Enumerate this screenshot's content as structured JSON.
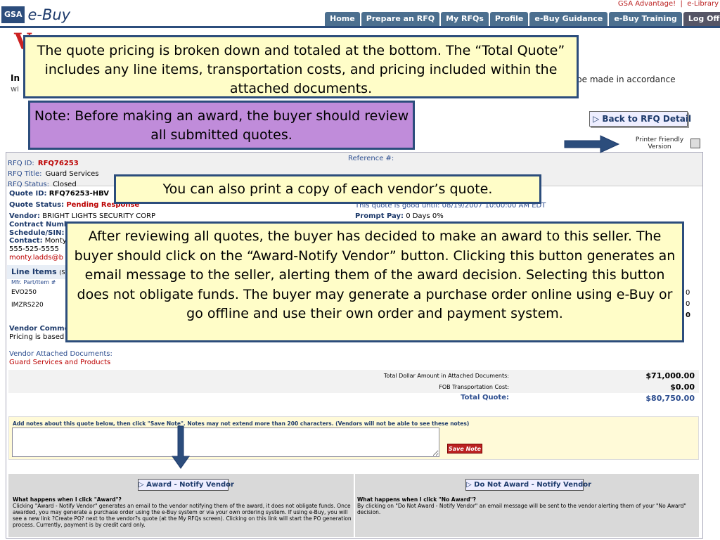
{
  "header": {
    "logo_box": "GSA",
    "logo_text": "e-Buy",
    "top_links": [
      "GSA Advantage!",
      "e-Library"
    ],
    "tabs": [
      "Home",
      "Prepare an RFQ",
      "My RFQs",
      "Profile",
      "e-Buy Guidance",
      "e-Buy Training",
      "Log Off"
    ]
  },
  "page": {
    "heading_fragment": "V",
    "in_text": "In",
    "wi_text": "wi",
    "accordance_text": "be made in accordance",
    "back_button": "Back to RFQ Detail",
    "printer_friendly": "Printer Friendly Version"
  },
  "rfq": {
    "id_label": "RFQ ID:",
    "id": "RFQ76253",
    "title_label": "RFQ Title:",
    "title": "Guard Services",
    "status_label": "RFQ Status:",
    "status": "Closed",
    "ref_label": "Reference #:"
  },
  "quote": {
    "id_label": "Quote ID:",
    "id": "RFQ76253-HBV",
    "status_label": "Quote Status:",
    "status": "Pending Response",
    "vendor_label": "Vendor:",
    "vendor": "BRIGHT LIGHTS SECURITY CORP",
    "contract_label": "Contract Numb",
    "schedule_label": "Schedule/SIN:",
    "contact_label": "Contact:",
    "contact": "Monty",
    "phone": "555-525-5555",
    "email": "monty.ladds@b",
    "good_until": "This quote is good until: 08/19/2007 10:00:00 AM EDT",
    "prompt_pay_label": "Prompt Pay:",
    "prompt_pay": "0 Days 0%",
    "line_items_label": "Line Items",
    "line_items_sub": "(Sp",
    "mfr_col": "Mfr. Part/Item #",
    "items": [
      "EVO250",
      "IMZRS220"
    ],
    "right_digits": [
      "0",
      "0",
      "0"
    ],
    "vendor_comments_label": "Vendor Comme",
    "vendor_comments": "Pricing is based",
    "attached_label": "Vendor Attached Documents:",
    "attached_doc": "Guard Services and Products"
  },
  "totals": [
    {
      "label": "Total Dollar Amount in Attached Documents:",
      "value": "$71,000.00"
    },
    {
      "label": "FOB Transportation Cost:",
      "value": "$0.00"
    },
    {
      "label": "Total Quote:",
      "value": "$80,750.00"
    }
  ],
  "notes": {
    "label": "Add notes about this quote below, then click \"Save Note\". Notes may not extend more than 200 characters. (Vendors will not be able to see these notes)",
    "save_button": "Save Note"
  },
  "award": {
    "award_button": "Award - Notify Vendor",
    "no_award_button": "Do Not Award - Notify Vendor",
    "award_q": "What happens when I click \"Award\"?",
    "award_text": "Clicking \"Award - Notify Vendor\" generates an email to the vendor notifying them of the award, it does not obligate funds. Once awarded, you may generate a purchase order using the e-Buy system or via your own ordering system. If using e-Buy, you will see a new link ?Create PO? next to the vendor?s quote (at the My RFQs screen). Clicking on this link will start the PO generation process. Currently, payment is by credit card only.",
    "no_award_q": "What happens when I click \"No Award\"?",
    "no_award_text": "By clicking on \"Do Not Award - Notify Vendor\" an email message will be sent to the vendor alerting them of your \"No Award\" decision."
  },
  "callouts": {
    "c1": "The quote pricing is broken down and totaled at the bottom.  The “Total Quote” includes any line items, transportation costs, and pricing included within the attached documents.",
    "c2": "Note: Before making an award, the buyer should review all submitted quotes.",
    "c3": "You can also print a copy of each vendor’s quote.",
    "c4": "After reviewing all quotes, the buyer has decided to make an award to this seller.  The buyer should click on the “Award-Notify Vendor” button.  Clicking this button generates an email message to the seller, alerting them of the award decision.  Selecting this button does not obligate funds.  The buyer may generate a purchase order online using e-Buy or go offline and use their own order and payment system."
  },
  "colors": {
    "brand_navy": "#2c4d7c",
    "callout_yellow": "#fffdc8",
    "callout_purple": "#c08cda",
    "alert_red": "#b22222"
  }
}
